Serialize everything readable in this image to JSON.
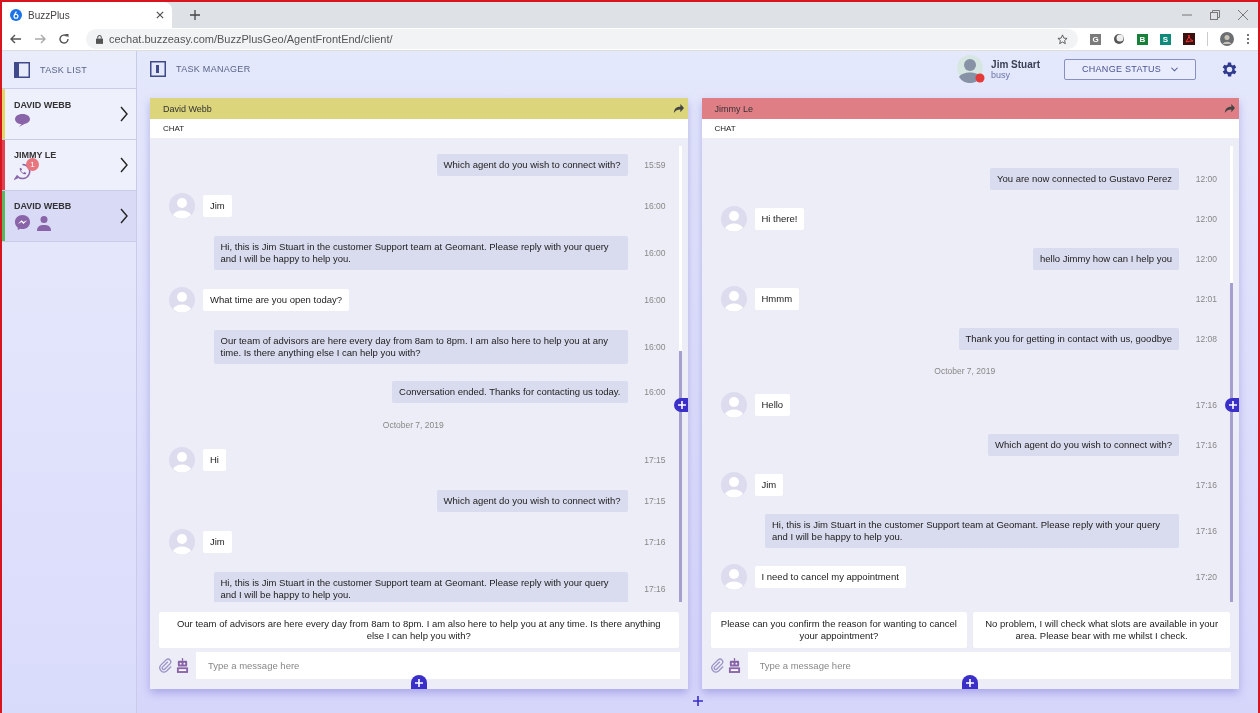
{
  "browser": {
    "tab_title": "BuzzPlus",
    "url": "cechat.buzzeasy.com/BuzzPlusGeo/AgentFrontEnd/client/",
    "extensions": [
      {
        "kind": "letter",
        "label": "G",
        "color": "#7b7b7b"
      },
      {
        "kind": "round"
      },
      {
        "kind": "letter",
        "label": "B",
        "color": "#188038"
      },
      {
        "kind": "letter",
        "label": "S",
        "color": "#0f8a7a"
      },
      {
        "kind": "pdf"
      }
    ]
  },
  "sidebar": {
    "title": "TASK LIST",
    "items": [
      {
        "name": "DAVID WEBB",
        "color": "#e6d66a",
        "channels": [
          {
            "kind": "sms"
          }
        ],
        "selected": false
      },
      {
        "name": "JIMMY LE",
        "color": "#e0434f",
        "channels": [
          {
            "kind": "whatsapp"
          }
        ],
        "badge": "1",
        "selected": false
      },
      {
        "name": "DAVID WEBB",
        "color": "#5cb85c",
        "channels": [
          {
            "kind": "messenger"
          },
          {
            "kind": "person"
          }
        ],
        "selected": true
      }
    ]
  },
  "header": {
    "title": "TASK MANAGER",
    "user": {
      "name": "Jim Stuart",
      "status": "busy"
    },
    "status_button": "CHANGE STATUS"
  },
  "panels": [
    {
      "contact": "David Webb",
      "color": "#dcd57c",
      "tab": "CHAT",
      "messages": [
        {
          "kind": "outgoing",
          "text": "Which agent do you wish to connect with?",
          "time": "15:59"
        },
        {
          "kind": "incoming",
          "text": "Jim",
          "time": "16:00"
        },
        {
          "kind": "outgoing",
          "text": "Hi, this is Jim Stuart in the customer Support team at Geomant. Please reply with your query and I will be happy to help you.",
          "time": "16:00"
        },
        {
          "kind": "incoming",
          "text": "What time are you open today?",
          "time": "16:00"
        },
        {
          "kind": "outgoing",
          "text": "Our team of advisors are here every day from 8am to 8pm. I am also here to help you at any time.  Is there anything else I can help you with?",
          "time": "16:00"
        },
        {
          "kind": "outgoing",
          "text": "Conversation ended. Thanks for contacting us today.",
          "time": "16:00"
        },
        {
          "kind": "date",
          "text": "October 7, 2019"
        },
        {
          "kind": "incoming",
          "text": "Hi",
          "time": "17:15"
        },
        {
          "kind": "outgoing",
          "text": "Which agent do you wish to connect with?",
          "time": "17:15"
        },
        {
          "kind": "incoming",
          "text": "Jim",
          "time": "17:16"
        },
        {
          "kind": "outgoing",
          "text": "Hi, this is Jim Stuart in the customer Support team at Geomant. Please reply with your query and I will be happy to help you.",
          "time": "17:16"
        }
      ],
      "suggestions": [
        "Our team of advisors are here every day from 8am to 8pm. I am also here to help you at any time.  Is there anything else I can help you with?"
      ],
      "input": {
        "placeholder": "Type a message here"
      }
    },
    {
      "contact": "Jimmy Le",
      "color": "#e07e86",
      "tab": "CHAT",
      "messages": [
        {
          "kind": "outgoing",
          "text": "You are now connected to Gustavo Perez",
          "time": "12:00"
        },
        {
          "kind": "incoming",
          "text": "Hi there!",
          "time": "12:00"
        },
        {
          "kind": "outgoing",
          "text": "hello Jimmy how can I help you",
          "time": "12:00"
        },
        {
          "kind": "incoming",
          "text": "Hmmm",
          "time": "12:01"
        },
        {
          "kind": "outgoing",
          "text": "Thank you for getting in contact with us, goodbye",
          "time": "12:08"
        },
        {
          "kind": "date",
          "text": "October 7, 2019"
        },
        {
          "kind": "incoming",
          "text": "Hello",
          "time": "17:16"
        },
        {
          "kind": "outgoing",
          "text": "Which agent do you wish to connect with?",
          "time": "17:16"
        },
        {
          "kind": "incoming",
          "text": "Jim",
          "time": "17:16"
        },
        {
          "kind": "outgoing",
          "text": "Hi, this is Jim Stuart in the customer Support team at Geomant. Please reply with your query and I will be happy to help you.",
          "time": "17:16"
        },
        {
          "kind": "incoming",
          "text": "I need to cancel my appointment",
          "time": "17:20"
        }
      ],
      "suggestions": [
        "Please can you confirm the reason for wanting to cancel your appointment?",
        "No problem, I will check what slots are available in your area. Please bear with me whilst I check."
      ],
      "input": {
        "placeholder": "Type a message here"
      }
    }
  ]
}
